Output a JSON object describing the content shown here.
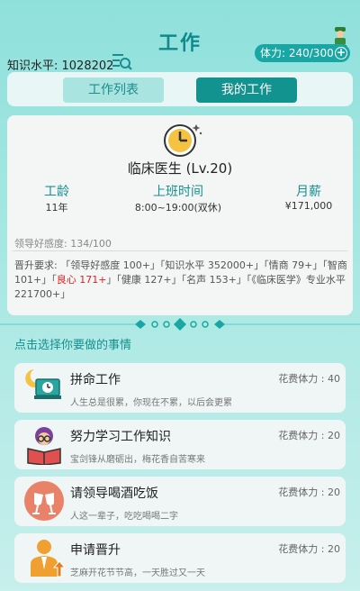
{
  "header": {
    "title": "工作",
    "stamina": "体力: 240/300",
    "stamina_plus": "+",
    "knowledge": "知识水平: 1028202"
  },
  "tabs": [
    {
      "label": "工作列表",
      "selected": false
    },
    {
      "label": "我的工作",
      "selected": true
    }
  ],
  "job": {
    "title": "临床医生 (Lv.20)",
    "stats": [
      {
        "label": "工龄",
        "value": "11年"
      },
      {
        "label": "上班时间",
        "value": "8:00~19:00(双休)"
      },
      {
        "label": "月薪",
        "value": "¥171,000"
      }
    ],
    "favor": "领导好感度: 134/100",
    "promotion": {
      "part1": "晋升要求: 「领导好感度 100+」「知识水平 352000+」「情商 79+」「智商 101+」「",
      "red": "良心 171+",
      "part2": "」「健康 127+」「名声 153+」「《临床医学》专业水平 221700+」"
    }
  },
  "section_title": "点击选择你要做的事情",
  "tasks": [
    {
      "name": "拼命工作",
      "cost": "花费体力 : 40",
      "desc": "人生总是很累，你现在不累，以后会更累",
      "icon": "night-work-icon"
    },
    {
      "name": "努力学习工作知识",
      "cost": "花费体力 : 20",
      "desc": "宝剑锋从磨砺出，梅花香自苦寒来",
      "icon": "study-icon"
    },
    {
      "name": "请领导喝酒吃饭",
      "cost": "花费体力 : 20",
      "desc": "人这一辈子，吃吃喝喝二字",
      "icon": "cheers-icon"
    },
    {
      "name": "申请晋升",
      "cost": "花费体力 : 20",
      "desc": "芝麻开花节节高，一天胜过又一天",
      "icon": "promotion-icon"
    }
  ],
  "colors": {
    "accent": "#12938f",
    "accent_light": "#a9e4e0",
    "warning": "#e02020",
    "background": "#a6e7e2"
  }
}
